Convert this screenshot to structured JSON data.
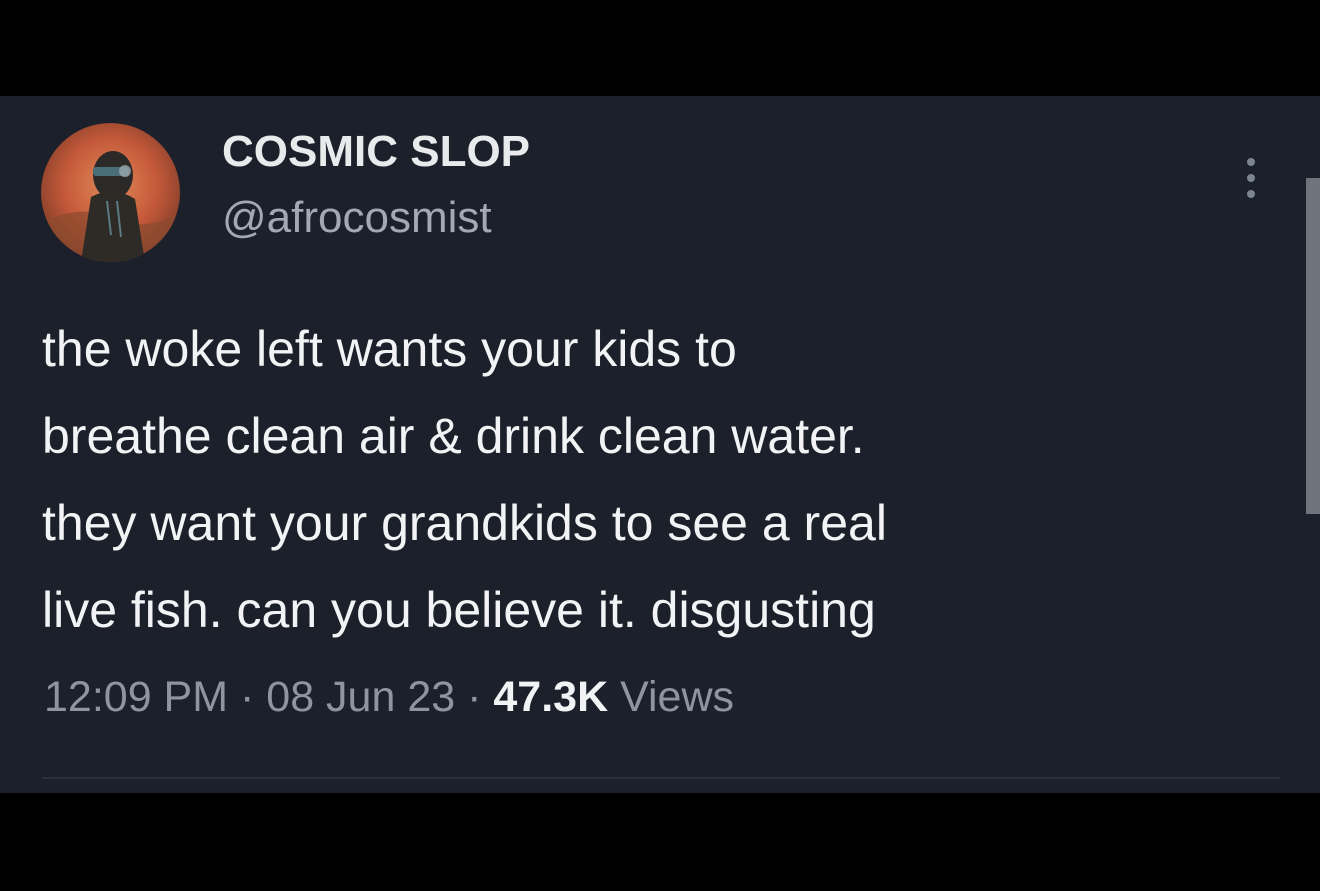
{
  "author": {
    "display_name": "COSMIC SLOP",
    "handle": "@afrocosmist",
    "avatar_icon": "profile-avatar"
  },
  "more_icon": "more-vertical-icon",
  "tweet": {
    "lines": [
      "the woke left wants your kids to",
      "breathe clean air & drink clean water.",
      "they want your grandkids to see a real",
      "live fish. can you believe it. disgusting"
    ]
  },
  "meta": {
    "time": "12:09 PM",
    "separator": " · ",
    "date": "08 Jun 23",
    "views_count": "47.3K",
    "views_label": " Views"
  },
  "colors": {
    "background": "#1c202a",
    "text": "#f2f3f5",
    "secondary_text": "#8e959f"
  }
}
